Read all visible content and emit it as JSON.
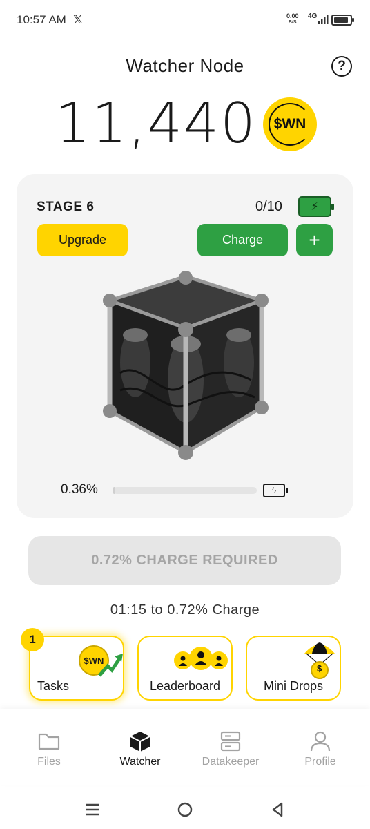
{
  "status_bar": {
    "time": "10:57 AM",
    "x_app": "𝕏",
    "net_speed_value": "0.00",
    "net_speed_unit": "B/S",
    "net_type": "4G"
  },
  "header": {
    "title": "Watcher Node",
    "help": "?"
  },
  "balance": {
    "amount": "11,440",
    "token": "$WN"
  },
  "node_card": {
    "stage": "STAGE 6",
    "charge_count": "0/10",
    "upgrade_label": "Upgrade",
    "charge_label": "Charge",
    "add_label": "+",
    "progress_text": "0.36%",
    "progress_value": 0.0036
  },
  "charge_required": {
    "label": "0.72% CHARGE REQUIRED",
    "timer_text": "01:15 to 0.72% Charge"
  },
  "tiles": {
    "tasks": {
      "label": "Tasks",
      "badge": "1",
      "coin_text": "$WN"
    },
    "leaderboard": {
      "label": "Leaderboard"
    },
    "mini_drops": {
      "label": "Mini Drops",
      "coin_text": "$"
    }
  },
  "bottom_nav": {
    "items": [
      {
        "label": "Files",
        "icon": "folder-icon",
        "active": false
      },
      {
        "label": "Watcher",
        "icon": "cube-icon",
        "active": true
      },
      {
        "label": "Datakeeper",
        "icon": "server-icon",
        "active": false
      },
      {
        "label": "Profile",
        "icon": "person-icon",
        "active": false
      }
    ]
  },
  "colors": {
    "accent_yellow": "#ffd400",
    "accent_green": "#2ea043",
    "card_bg": "#f4f4f4",
    "disabled_text": "#a5a5a5"
  }
}
